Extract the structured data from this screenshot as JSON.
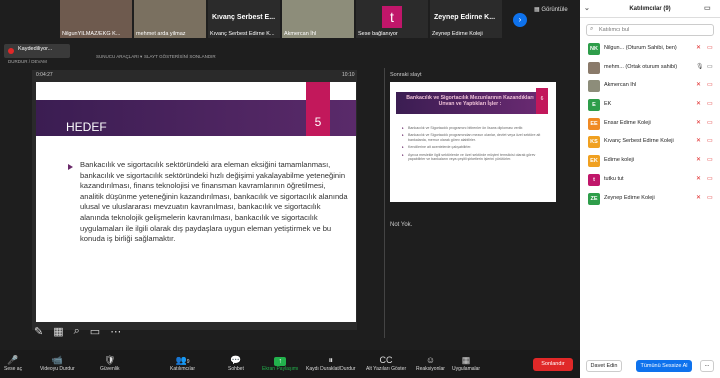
{
  "thumbnails": [
    {
      "name": "NilgunYILMAZ/EKG K...",
      "bg": "#6e5a4e"
    },
    {
      "name": "mehmet arda yilmaz",
      "bg": "#7a7060"
    },
    {
      "name": "Kıvanç Serbest Edirne K...",
      "big": "Kıvanç Serbest E...",
      "bg": "#2b2b2b"
    },
    {
      "name": "Akmercan İhl",
      "bg": "#8d8d7a"
    },
    {
      "name": "Sese bağlanıyor",
      "avatar": "t",
      "bg": "#2b2b2b"
    },
    {
      "name": "Zeynep Edirne Koleji",
      "big": "Zeynep Edirne K...",
      "bg": "#2b2b2b"
    }
  ],
  "view_label": "Görüntüle",
  "recording": {
    "label": "Kaydediliyor...",
    "sub": "DURDUR / DEVAM"
  },
  "share_meta": {
    "left": "SUNUCU ARAÇLARI ▾",
    "right": "SLAYT GÖSTERİSİNİ SONLANDIR"
  },
  "presenter": {
    "elapsed": "0:04:27",
    "clock": "10:10"
  },
  "slide": {
    "title": "HEDEF",
    "number": "5",
    "body": "Bankacılık ve sigortacılık sektöründeki ara eleman eksiğini tamamlanması, bankacılık ve sigortacılık sektöründeki hızlı değişimi yakalayabilme yeteneğinin kazandırılması, finans teknolojisi ve finansman kavramlarının öğretilmesi, analitik düşünme yeteneğinin kazandırılması, bankacılık ve sigortacılık alanında ulusal ve uluslararası mevzuatın kavranılması, bankacılık ve sigortacılık alanında teknolojik gelişmelerin kavranılması, bankacılık ve sigortacılık uygulamaları ile ilgili olarak dış paydaşlara uygun eleman yetiştirmek ve bu konuda iş birliği sağlamaktır."
  },
  "next_slide": {
    "label": "Sonraki slayt",
    "title": "Bankacılık ve Sigortacılık Mezunlarının Kazandıkları Unvan ve Yaptıkları İşler :",
    "number": "6",
    "bullets": [
      "Bankacılık ve Sigortacılık programını bitirenler ön lisans diploması verilir.",
      "Bankacılık ve Sigortacılık programından mezun olanlar, devlet veya özel sektöre ait bankalarda, memur olarak görev alabilirler.",
      "Kendilerine ait acentelerde çalışabilirler.",
      "Ayrıca meslekle ilgili sektörlerde ve özel sektörde müşteri temsilcisi olarak görev yapabilirler ve bankaların veya çeşitli şirketlerin işlerini yürütürler."
    ]
  },
  "notes": "Not Yok.",
  "toolbar": [
    {
      "label": "Sese aç",
      "icon": "🎤"
    },
    {
      "label": "Videoyu Durdur",
      "icon": "📹"
    },
    {
      "label": "Güvenlik",
      "icon": "🛡"
    },
    {
      "label": "Katılımcılar",
      "icon": "👥",
      "count": "9"
    },
    {
      "label": "Sohbet",
      "icon": "💬"
    },
    {
      "label": "Ekran Paylaşımı",
      "icon": "↑"
    },
    {
      "label": "Kaydı Duraklat/Durdur",
      "icon": "⏸"
    },
    {
      "label": "Alt Yazıları Göster",
      "icon": "CC"
    },
    {
      "label": "Reaksiyonlar",
      "icon": "☺"
    },
    {
      "label": "Uygulamalar",
      "icon": "▦"
    }
  ],
  "end_button": "Sonlandır",
  "panel": {
    "title": "Katılımcılar (9)",
    "search_placeholder": "Katılımcı bul",
    "participants": [
      {
        "initials": "NK",
        "color": "#2e9d4a",
        "name": "Nilgun... (Oturum Sahibi, ben)"
      },
      {
        "initials": "",
        "color": "#8a7a6a",
        "name": "mehm... (Ortak oturum sahibi)"
      },
      {
        "initials": "",
        "color": "#8d8d7a",
        "name": "Akmercan İhl"
      },
      {
        "initials": "E",
        "color": "#2e9d4a",
        "name": "EK"
      },
      {
        "initials": "EE",
        "color": "#f08a24",
        "name": "Ensar Edirne Koleji"
      },
      {
        "initials": "KS",
        "color": "#f0a020",
        "name": "Kıvanç Serbest Edirne Koleji"
      },
      {
        "initials": "EK",
        "color": "#f0a020",
        "name": "Edirne koleji"
      },
      {
        "initials": "t",
        "color": "#c0166a",
        "name": "tutku tut"
      },
      {
        "initials": "ZE",
        "color": "#2e9d4a",
        "name": "Zeynep Edirne Koleji"
      }
    ],
    "invite": "Davet Edin",
    "mute_all": "Tümünü Sessize Al",
    "more": "..."
  }
}
